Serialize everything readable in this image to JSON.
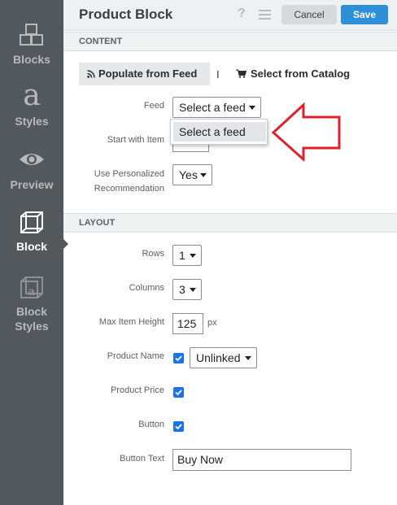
{
  "sidebar": {
    "items": [
      {
        "label": "Blocks",
        "icon": "blocks-icon"
      },
      {
        "label": "Styles",
        "icon": "styles-icon"
      },
      {
        "label": "Preview",
        "icon": "preview-icon"
      },
      {
        "label": "Block",
        "icon": "block-icon",
        "active": true
      },
      {
        "label": "Block Styles",
        "label_line1": "Block",
        "label_line2": "Styles",
        "icon": "block-styles-icon"
      }
    ]
  },
  "header": {
    "title": "Product Block",
    "help_label": "?",
    "cancel_label": "Cancel",
    "save_label": "Save"
  },
  "content": {
    "section_title": "CONTENT",
    "tabs": {
      "populate_label": "Populate from Feed",
      "separator": "I",
      "catalog_label": "Select from Catalog"
    },
    "feed": {
      "label": "Feed",
      "value": "Select a feed"
    },
    "feed_dropdown": {
      "options": [
        "Select a feed"
      ]
    },
    "start_item": {
      "label": "Start with Item",
      "value": ""
    },
    "personalized": {
      "label_line1": "Use Personalized",
      "label_line2": "Recommendation",
      "value": "Yes"
    }
  },
  "layout": {
    "section_title": "LAYOUT",
    "rows": {
      "label": "Rows",
      "value": "1"
    },
    "columns": {
      "label": "Columns",
      "value": "3"
    },
    "max_height": {
      "label": "Max Item Height",
      "value": "125",
      "unit": "px"
    },
    "product_name": {
      "label": "Product Name",
      "checked": true,
      "link_value": "Unlinked"
    },
    "product_price": {
      "label": "Product Price",
      "checked": true
    },
    "button": {
      "label": "Button",
      "checked": true
    },
    "button_text": {
      "label": "Button Text",
      "value": "Buy Now"
    }
  },
  "colors": {
    "sidebar_bg": "#53585d",
    "save_button": "#2f8fd8",
    "checkbox": "#1a73e8",
    "annotation_arrow": "#e0202a"
  }
}
